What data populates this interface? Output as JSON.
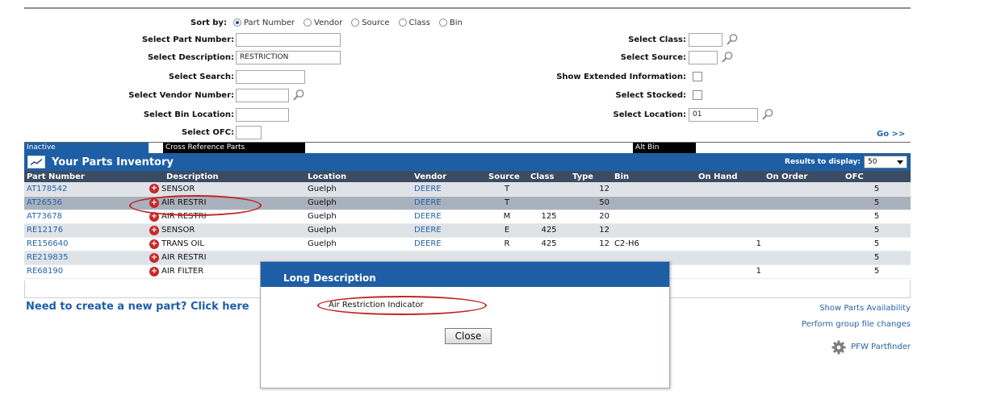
{
  "sort": {
    "label": "Sort by:",
    "options": [
      {
        "label": "Part Number",
        "selected": true
      },
      {
        "label": "Vendor",
        "selected": false
      },
      {
        "label": "Source",
        "selected": false
      },
      {
        "label": "Class",
        "selected": false
      },
      {
        "label": "Bin",
        "selected": false
      }
    ]
  },
  "form": {
    "part_number": {
      "label": "Select Part Number:",
      "value": ""
    },
    "description": {
      "label": "Select Description:",
      "value": "RESTRICTION"
    },
    "search": {
      "label": "Select Search:",
      "value": ""
    },
    "vendor_number": {
      "label": "Select Vendor Number:",
      "value": ""
    },
    "bin_location": {
      "label": "Select Bin Location:",
      "value": ""
    },
    "ofc": {
      "label": "Select OFC:",
      "value": ""
    },
    "class": {
      "label": "Select Class:",
      "value": ""
    },
    "source": {
      "label": "Select Source:",
      "value": ""
    },
    "extended": {
      "label": "Show Extended Information:",
      "checked": false
    },
    "stocked": {
      "label": "Select Stocked:",
      "checked": false
    },
    "location": {
      "label": "Select Location:",
      "value": "01"
    },
    "go_label": "Go >>"
  },
  "legend": {
    "inactive": "Inactive",
    "cross_reference": "Cross Reference Parts",
    "alt_bin": "Alt Bin",
    "colors": {
      "inactive": "#1e5ea4",
      "cross_reference": "#000000",
      "alt_bin": "#000000"
    }
  },
  "inventory": {
    "title": "Your Parts Inventory",
    "results_label": "Results to display:",
    "results_value": "50",
    "columns": [
      "Part Number",
      "Description",
      "Location",
      "Vendor",
      "Source",
      "Class",
      "Type",
      "Bin",
      "On Hand",
      "On Order",
      "OFC"
    ],
    "rows": [
      {
        "part": "AT178542",
        "desc": "SENSOR",
        "location": "Guelph",
        "vendor": "DEERE",
        "source": "T",
        "class": "",
        "type": "12",
        "bin": "",
        "on_hand": "",
        "on_order": "",
        "ofc": "5"
      },
      {
        "part": "AT26536",
        "desc": "AIR RESTRI",
        "location": "Guelph",
        "vendor": "DEERE",
        "source": "T",
        "class": "",
        "type": "50",
        "bin": "",
        "on_hand": "",
        "on_order": "",
        "ofc": "5"
      },
      {
        "part": "AT73678",
        "desc": "AIR RESTRI",
        "location": "Guelph",
        "vendor": "DEERE",
        "source": "M",
        "class": "125",
        "type": "20",
        "bin": "",
        "on_hand": "",
        "on_order": "",
        "ofc": "5"
      },
      {
        "part": "RE12176",
        "desc": "SENSOR",
        "location": "Guelph",
        "vendor": "DEERE",
        "source": "E",
        "class": "425",
        "type": "12",
        "bin": "",
        "on_hand": "",
        "on_order": "",
        "ofc": "5"
      },
      {
        "part": "RE156640",
        "desc": "TRANS OIL",
        "location": "Guelph",
        "vendor": "DEERE",
        "source": "R",
        "class": "425",
        "type": "12",
        "bin": "C2-H6",
        "on_hand": "1",
        "on_order": "",
        "ofc": "5"
      },
      {
        "part": "RE219835",
        "desc": "AIR RESTRI",
        "location": "",
        "vendor": "",
        "source": "",
        "class": "",
        "type": "",
        "bin": "",
        "on_hand": "",
        "on_order": "",
        "ofc": "5"
      },
      {
        "part": "RE68190",
        "desc": "AIR FILTER",
        "location": "",
        "vendor": "",
        "source": "",
        "class": "",
        "type": "",
        "bin": "",
        "on_hand": "1",
        "on_order": "",
        "ofc": "5"
      }
    ]
  },
  "new_part_text": "Need to create a new part? Click here",
  "side_links": {
    "availability": "Show Parts Availability",
    "group_changes": "Perform group file changes",
    "portfinder": "PFW Partfinder"
  },
  "modal": {
    "title": "Long Description",
    "text": "Air Restriction Indicator",
    "close_label": "Close"
  },
  "colors": {
    "header_blue": "#1e5ea4",
    "link_blue": "#2464a8",
    "annotation_red": "#c22525"
  }
}
